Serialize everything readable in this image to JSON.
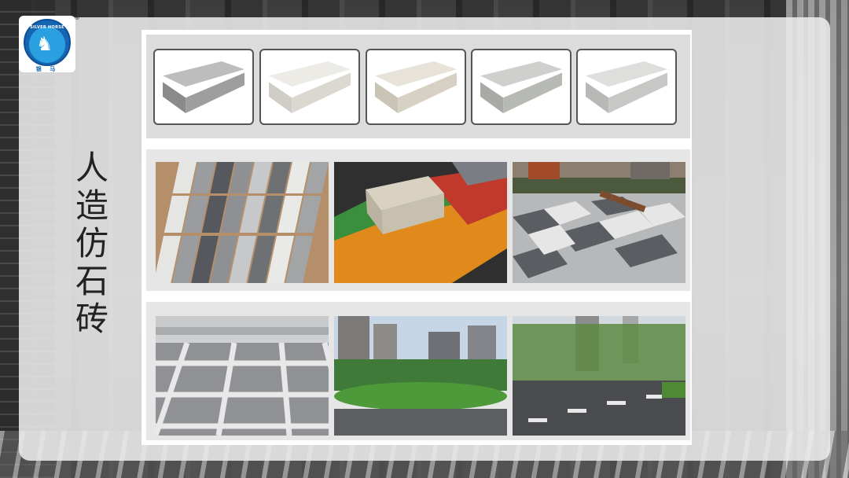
{
  "title_chars": [
    "人",
    "造",
    "仿",
    "石",
    "砖"
  ],
  "logo": {
    "text_en": "SILVER HORSE",
    "text_cn": "银 马",
    "registered": "®"
  },
  "bricks": [
    {
      "name": "grey-granite-brick",
      "top": "#bdbdbd",
      "front": "#8a8a8a",
      "side": "#9e9e9e"
    },
    {
      "name": "white-speckled-brick",
      "top": "#ecebe6",
      "front": "#cfcdc6",
      "side": "#dad8d1"
    },
    {
      "name": "cream-speckled-brick",
      "top": "#e7e3d9",
      "front": "#c9c4b6",
      "side": "#d6d1c4"
    },
    {
      "name": "light-grey-speckled-brick",
      "top": "#cfd0cd",
      "front": "#a8aaa6",
      "side": "#b7b9b5"
    },
    {
      "name": "pale-grey-brick",
      "top": "#dedfdc",
      "front": "#b8b9b6",
      "side": "#c7c8c5"
    }
  ],
  "photos": [
    {
      "name": "striped-paving-photo"
    },
    {
      "name": "colored-bricks-photo"
    },
    {
      "name": "plaza-paving-photo"
    },
    {
      "name": "steps-grid-paving-photo"
    },
    {
      "name": "residential-lawn-photo"
    },
    {
      "name": "park-path-photo"
    }
  ]
}
